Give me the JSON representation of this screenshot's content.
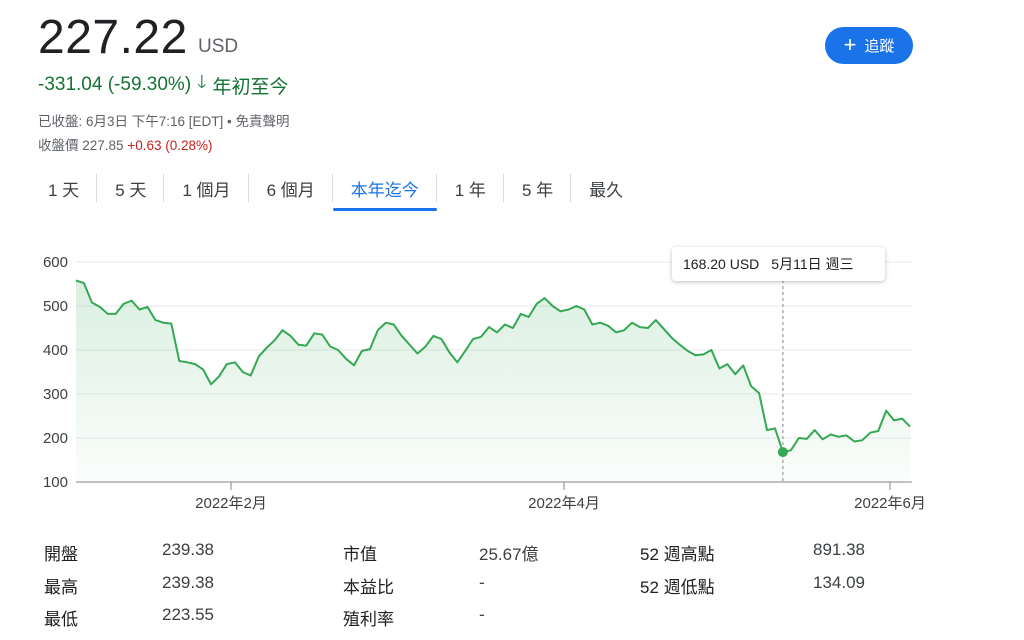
{
  "quote": {
    "price": "227.22",
    "currency": "USD",
    "change": "-331.04 (-59.30%)",
    "change_period": "年初至今",
    "closed_line": "已收盤: 6月3日 下午7:16 [EDT] • 免責聲明",
    "close_label": "收盤價 227.85",
    "close_change": "+0.63 (0.28%)"
  },
  "follow_button": {
    "label": "追蹤"
  },
  "tabs": [
    {
      "label": "1 天"
    },
    {
      "label": "5 天"
    },
    {
      "label": "1 個月"
    },
    {
      "label": "6 個月"
    },
    {
      "label": "本年迄今",
      "active": true
    },
    {
      "label": "1 年"
    },
    {
      "label": "5 年"
    },
    {
      "label": "最久"
    }
  ],
  "tooltip": {
    "value": "168.20 USD",
    "date": "5月11日 週三"
  },
  "chart_data": {
    "type": "area",
    "ylim": [
      100,
      600
    ],
    "yticks": [
      "600",
      "500",
      "400",
      "300",
      "200",
      "100"
    ],
    "xtick_labels": [
      "2022年2月",
      "2022年4月",
      "2022年6月"
    ],
    "grid": true,
    "line_color": "#34a853",
    "series": [
      {
        "values": [
          558,
          552,
          508,
          498,
          482,
          482,
          505,
          512,
          492,
          498,
          468,
          462,
          460,
          375,
          372,
          368,
          356,
          322,
          340,
          368,
          372,
          350,
          342,
          385,
          405,
          422,
          445,
          432,
          412,
          410,
          438,
          435,
          408,
          400,
          380,
          365,
          398,
          402,
          445,
          462,
          458,
          432,
          412,
          392,
          408,
          432,
          425,
          395,
          372,
          398,
          425,
          430,
          452,
          440,
          458,
          450,
          482,
          475,
          505,
          518,
          500,
          488,
          492,
          500,
          492,
          458,
          462,
          455,
          440,
          445,
          462,
          452,
          450,
          468,
          448,
          428,
          412,
          398,
          388,
          390,
          400,
          358,
          368,
          345,
          365,
          318,
          302,
          218,
          222,
          168,
          172,
          200,
          198,
          218,
          197,
          208,
          203,
          206,
          192,
          195,
          212,
          216,
          262,
          240,
          244,
          226
        ]
      }
    ]
  },
  "stats": {
    "col1": [
      {
        "label": "開盤",
        "value": "239.38"
      },
      {
        "label": "最高",
        "value": "239.38"
      },
      {
        "label": "最低",
        "value": "223.55"
      }
    ],
    "col2": [
      {
        "label": "市值",
        "value": "25.67億"
      },
      {
        "label": "本益比",
        "value": "-"
      },
      {
        "label": "殖利率",
        "value": "-"
      }
    ],
    "col3": [
      {
        "label": "52 週高點",
        "value": "891.38"
      },
      {
        "label": "52 週低點",
        "value": "134.09"
      }
    ]
  }
}
